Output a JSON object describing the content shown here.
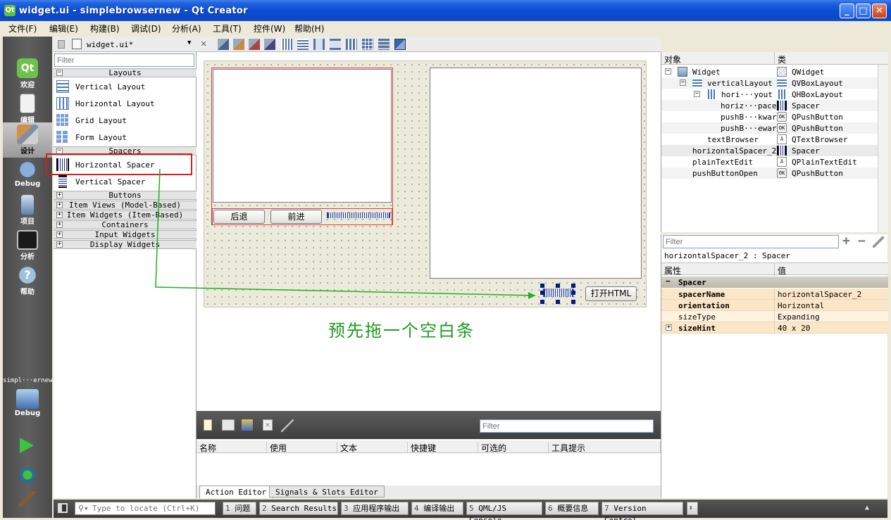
{
  "window": {
    "title": "widget.ui - simplebrowsernew - Qt Creator"
  },
  "menu": [
    "文件(F)",
    "编辑(E)",
    "构建(B)",
    "调试(D)",
    "分析(A)",
    "工具(T)",
    "控件(W)",
    "帮助(H)"
  ],
  "modes": [
    "欢迎",
    "编辑",
    "设计",
    "Debug",
    "项目",
    "分析",
    "帮助"
  ],
  "project": {
    "name": "simpl···ernew",
    "config": "Debug"
  },
  "editor": {
    "file": "widget.ui*"
  },
  "widgetbox": {
    "filter_placeholder": "Filter",
    "categories": {
      "layouts": "Layouts",
      "spacers": "Spacers",
      "buttons": "Buttons",
      "item_views": "Item Views (Model-Based)",
      "item_widgets": "Item Widgets (Item-Based)",
      "containers": "Containers",
      "input_widgets": "Input Widgets",
      "display_widgets": "Display Widgets"
    },
    "layout_items": [
      "Vertical Layout",
      "Horizontal Layout",
      "Grid Layout",
      "Form Layout"
    ],
    "spacer_items": [
      "Horizontal Spacer",
      "Vertical Spacer"
    ]
  },
  "form": {
    "back_button": "后退",
    "forward_button": "前进",
    "open_button": "打开HTML"
  },
  "annotation": {
    "text": "预先拖一个空白条",
    "color": "#1f9a1f"
  },
  "action_editor": {
    "filter_placeholder": "Filter",
    "columns": [
      "名称",
      "使用",
      "文本",
      "快捷键",
      "可选的",
      "工具提示"
    ],
    "tabs": [
      "Action Editor",
      "Signals & Slots Editor"
    ]
  },
  "object_inspector": {
    "headers": [
      "对象",
      "类"
    ],
    "rows": [
      {
        "name": "Widget",
        "class": "QWidget"
      },
      {
        "name": "verticalLayout",
        "class": "QVBoxLayout"
      },
      {
        "name": "hori···yout",
        "class": "QHBoxLayout"
      },
      {
        "name": "horiz···pacer",
        "class": "Spacer"
      },
      {
        "name": "pushB···kward",
        "class": "QPushButton"
      },
      {
        "name": "pushB···eward",
        "class": "QPushButton"
      },
      {
        "name": "textBrowser",
        "class": "QTextBrowser"
      },
      {
        "name": "horizontalSpacer_2",
        "class": "Spacer"
      },
      {
        "name": "plainTextEdit",
        "class": "QPlainTextEdit"
      },
      {
        "name": "pushButtonOpen",
        "class": "QPushButton"
      }
    ]
  },
  "property_editor": {
    "filter_placeholder": "Filter",
    "subject": "horizontalSpacer_2 : Spacer",
    "headers": [
      "属性",
      "值"
    ],
    "group": "Spacer",
    "rows": [
      {
        "name": "spacerName",
        "value": "horizontalSpacer_2"
      },
      {
        "name": "orientation",
        "value": "Horizontal"
      },
      {
        "name": "sizeType",
        "value": "Expanding"
      },
      {
        "name": "sizeHint",
        "value": "40 x 20"
      }
    ]
  },
  "statusbar": {
    "locator_placeholder": "Type to locate (Ctrl+K)",
    "panes": [
      {
        "num": "1",
        "label": "问题"
      },
      {
        "num": "2",
        "label": "Search Results"
      },
      {
        "num": "3",
        "label": "应用程序输出"
      },
      {
        "num": "4",
        "label": "编译输出"
      },
      {
        "num": "5",
        "label": "QML/JS Console"
      },
      {
        "num": "6",
        "label": "概要信息"
      },
      {
        "num": "7",
        "label": "Version Control"
      }
    ]
  }
}
